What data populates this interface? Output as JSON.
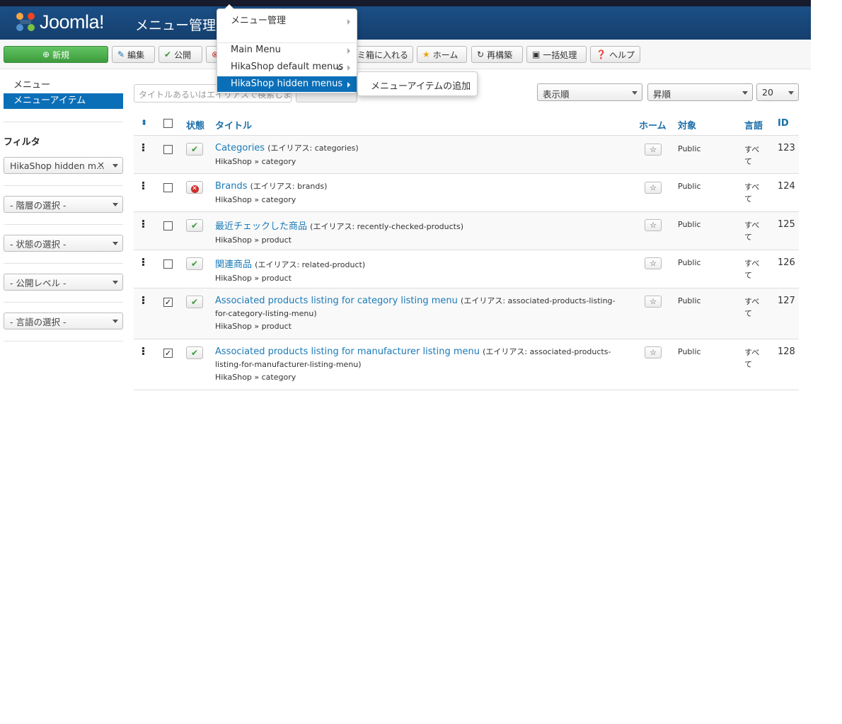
{
  "header": {
    "logo_text": "Joomla!",
    "page_title": "メニュー管理:"
  },
  "toolbar": {
    "new": "新規",
    "edit": "編集",
    "publish": "公開",
    "unpublish": "",
    "trash": "ミ箱に入れる",
    "home": "ホーム",
    "rebuild": "再構築",
    "batch": "一括処理",
    "help": "ヘルプ"
  },
  "sidebar": {
    "items": [
      {
        "label": "メニュー",
        "active": false
      },
      {
        "label": "メニューアイテム",
        "active": true
      }
    ],
    "filter_title": "フィルタ",
    "filters": [
      {
        "label": "HikaShop hidden m...",
        "clearable": true
      },
      {
        "label": "- 階層の選択 -",
        "clearable": false
      },
      {
        "label": "- 状態の選択 -",
        "clearable": false
      },
      {
        "label": "- 公開レベル -",
        "clearable": false
      },
      {
        "label": "- 言語の選択 -",
        "clearable": false
      }
    ]
  },
  "search": {
    "placeholder": "タイトルあるいはエイリアスで検索します"
  },
  "sort": {
    "ordering": "表示順",
    "direction": "昇順",
    "limit": "20"
  },
  "table": {
    "headers": {
      "status": "状態",
      "title": "タイトル",
      "home": "ホーム",
      "access": "対象",
      "language": "言語",
      "id": "ID"
    },
    "alias_prefix": "(エイリアス: ",
    "rows": [
      {
        "title": "Categories",
        "alias": "categories)",
        "component": "HikaShop » category",
        "published": true,
        "checked": false,
        "access": "Public",
        "language": "すべて",
        "id": "123"
      },
      {
        "title": "Brands",
        "alias": "brands)",
        "component": "HikaShop » category",
        "published": false,
        "checked": false,
        "access": "Public",
        "language": "すべて",
        "id": "124"
      },
      {
        "title": "最近チェックした商品",
        "alias": "recently-checked-products)",
        "component": "HikaShop » product",
        "published": true,
        "checked": false,
        "access": "Public",
        "language": "すべて",
        "id": "125"
      },
      {
        "title": "関連商品",
        "alias": "related-product)",
        "component": "HikaShop » product",
        "published": true,
        "checked": false,
        "access": "Public",
        "language": "すべて",
        "id": "126"
      },
      {
        "title": "Associated products listing for category listing menu",
        "alias": "associated-products-listing-for-category-listing-menu)",
        "component": "HikaShop » product",
        "published": true,
        "checked": true,
        "access": "Public",
        "language": "すべて",
        "id": "127"
      },
      {
        "title": "Associated products listing for manufacturer listing menu",
        "alias": "associated-products-listing-for-manufacturer-listing-menu)",
        "component": "HikaShop » category",
        "published": true,
        "checked": true,
        "access": "Public",
        "language": "すべて",
        "id": "128"
      }
    ]
  },
  "dropdown": {
    "items": [
      "メニュー管理",
      "Main Menu",
      "HikaShop default menus",
      "HikaShop hidden menus"
    ],
    "submenu_item": "メニューアイテムの追加"
  }
}
